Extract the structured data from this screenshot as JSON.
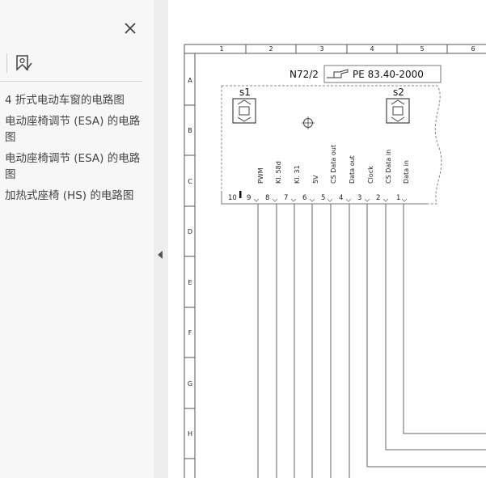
{
  "sidebar": {
    "close_glyph": "✕",
    "bookmarks": [
      "4 折式电动车窗的电路图",
      "电动座椅调节 (ESA) 的电路图",
      "电动座椅调节 (ESA) 的电路图",
      "加热式座椅 (HS) 的电路图"
    ]
  },
  "drawing": {
    "columns": [
      "1",
      "2",
      "3",
      "4",
      "5",
      "6"
    ],
    "rows": [
      "A",
      "B",
      "C",
      "D",
      "E",
      "F",
      "G",
      "H"
    ],
    "component": "N72/2",
    "reference": "PE 83.40-2000",
    "switch_left": "s1",
    "switch_right": "s2",
    "pins": [
      "10",
      "9",
      "8",
      "7",
      "6",
      "5",
      "4",
      "3",
      "2",
      "1"
    ],
    "signals": [
      "PWM",
      "Kl. 58d",
      "Kl. 31",
      "5V",
      "CS Data out",
      "Data out",
      "Clock",
      "CS Data in",
      "Data in"
    ]
  },
  "colors": {
    "sidebar_bg": "#f7f7f7",
    "divider_bg": "#eeeeee",
    "line": "#555555"
  }
}
